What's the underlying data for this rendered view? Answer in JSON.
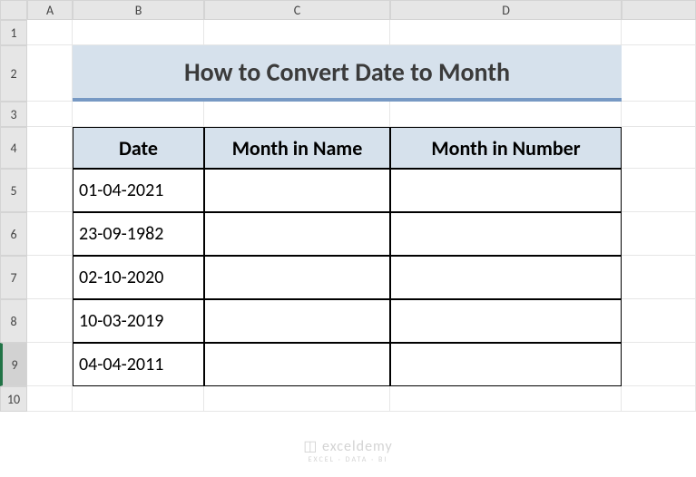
{
  "columns": [
    "A",
    "B",
    "C",
    "D"
  ],
  "rows": [
    "1",
    "2",
    "3",
    "4",
    "5",
    "6",
    "7",
    "8",
    "9",
    "10"
  ],
  "title": "How to Convert Date to Month",
  "table": {
    "headers": {
      "date": "Date",
      "month_name": "Month in Name",
      "month_number": "Month in Number"
    },
    "data": [
      {
        "date": "01-04-2021",
        "month_name": "",
        "month_number": ""
      },
      {
        "date": "23-09-1982",
        "month_name": "",
        "month_number": ""
      },
      {
        "date": "02-10-2020",
        "month_name": "",
        "month_number": ""
      },
      {
        "date": "10-03-2019",
        "month_name": "",
        "month_number": ""
      },
      {
        "date": "04-04-2011",
        "month_name": "",
        "month_number": ""
      }
    ]
  },
  "selected_row": "9",
  "watermark": {
    "brand": "exceldemy",
    "tagline": "EXCEL · DATA · BI"
  }
}
